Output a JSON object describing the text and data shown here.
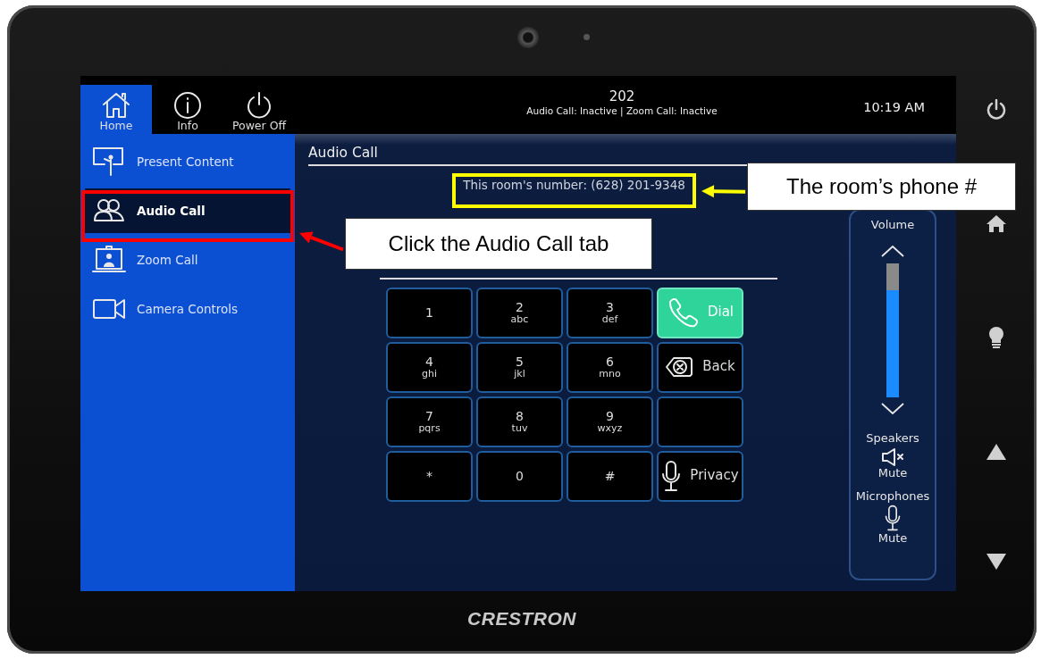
{
  "top_bar": {
    "tabs": [
      {
        "kind": "home",
        "label": "Home",
        "selected": true
      },
      {
        "kind": "info",
        "label": "Info",
        "selected": false
      },
      {
        "kind": "power",
        "label": "Power Off",
        "selected": false
      }
    ],
    "room": "202",
    "status": "Audio Call: Inactive | Zoom Call: Inactive",
    "time": "10:19 AM"
  },
  "sidebar": {
    "items": [
      {
        "kind": "present",
        "label": "Present Content",
        "selected": false
      },
      {
        "kind": "audio",
        "label": "Audio Call",
        "selected": true
      },
      {
        "kind": "zoom",
        "label": "Zoom Call",
        "selected": false
      },
      {
        "kind": "camera",
        "label": "Camera Controls",
        "selected": false
      }
    ]
  },
  "main": {
    "title": "Audio Call",
    "room_number": "This room's number: (628) 201-9348",
    "keys": [
      {
        "kind": "digit",
        "digit": "1"
      },
      {
        "kind": "digit",
        "digit": "2",
        "letters": "abc"
      },
      {
        "kind": "digit",
        "digit": "3",
        "letters": "def"
      },
      {
        "kind": "dial",
        "label": "Dial"
      },
      {
        "kind": "digit",
        "digit": "4",
        "letters": "ghi"
      },
      {
        "kind": "digit",
        "digit": "5",
        "letters": "jkl"
      },
      {
        "kind": "digit",
        "digit": "6",
        "letters": "mno"
      },
      {
        "kind": "back",
        "label": "Back"
      },
      {
        "kind": "digit",
        "digit": "7",
        "letters": "pqrs"
      },
      {
        "kind": "digit",
        "digit": "8",
        "letters": "tuv"
      },
      {
        "kind": "digit",
        "digit": "9",
        "letters": "wxyz"
      },
      {
        "kind": "blank"
      },
      {
        "kind": "digit",
        "digit": "*"
      },
      {
        "kind": "digit",
        "digit": "0"
      },
      {
        "kind": "digit",
        "digit": "#"
      },
      {
        "kind": "privacy",
        "label": "Privacy"
      }
    ]
  },
  "audio_panel": {
    "volume": {
      "label": "Volume",
      "level": 0.8
    },
    "speakers": {
      "label": "Speakers",
      "mute_label": "Mute"
    },
    "microphones": {
      "label": "Microphones",
      "mute_label": "Mute"
    }
  },
  "device": {
    "brand": "CRESTRON"
  },
  "annotations": [
    {
      "kind": "tab_highlight",
      "color": "#ff0000",
      "text": "Click the Audio Call tab"
    },
    {
      "kind": "number_highlight",
      "color": "#ffff00",
      "text": "The room’s phone #"
    }
  ]
}
